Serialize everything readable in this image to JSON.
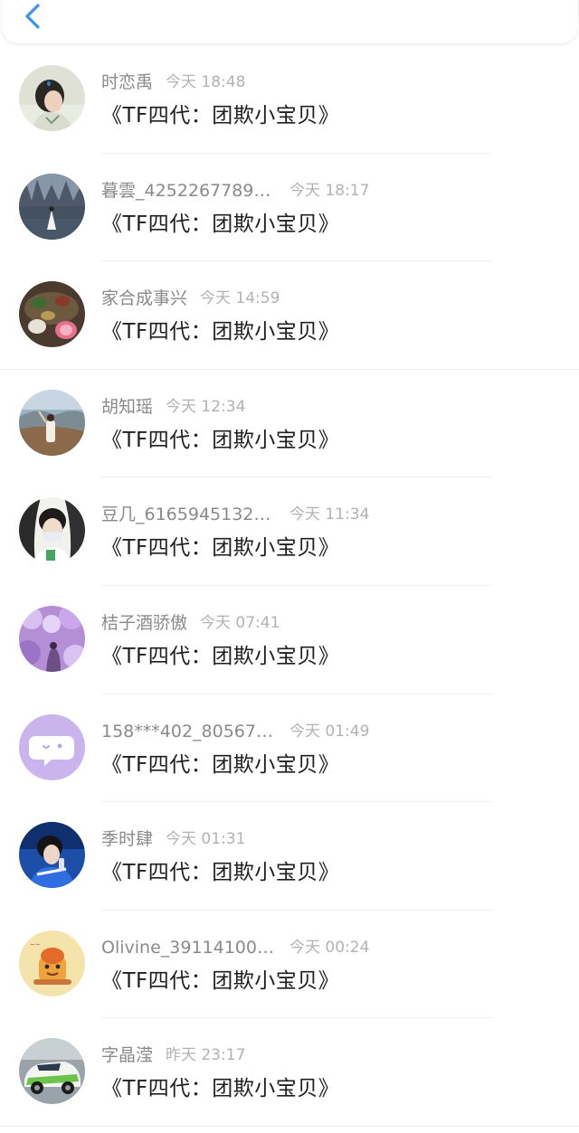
{
  "header": {
    "back_icon": "chevron-left-icon",
    "accent_color": "#3d8ff0"
  },
  "messages": [
    {
      "name": "时恋禹",
      "time": "今天 18:48",
      "text": "《TF四代：团欺小宝贝》",
      "avatar": "avatar-person-photo"
    },
    {
      "name": "暮雲_4252267789…",
      "time": "今天 18:17",
      "text": "《TF四代：团欺小宝贝》",
      "avatar": "avatar-misty-forest"
    },
    {
      "name": "家合成事兴",
      "time": "今天 14:59",
      "text": "《TF四代：团欺小宝贝》",
      "avatar": "avatar-food-table"
    },
    {
      "name": "胡知瑶",
      "time": "今天 12:34",
      "text": "《TF四代：团欺小宝贝》",
      "avatar": "avatar-mountain-girl"
    },
    {
      "name": "豆几_6165945132…",
      "time": "今天 11:34",
      "text": "《TF四代：团欺小宝贝》",
      "avatar": "avatar-masked-boy"
    },
    {
      "name": "桔子酒骄傲",
      "time": "今天 07:41",
      "text": "《TF四代：团欺小宝贝》",
      "avatar": "avatar-purple-blossom"
    },
    {
      "name": "158***402_80567…",
      "time": "今天 01:49",
      "text": "《TF四代：团欺小宝贝》",
      "avatar": "avatar-default-chat-bubble"
    },
    {
      "name": "季时肆",
      "time": "今天 01:31",
      "text": "《TF四代：团欺小宝贝》",
      "avatar": "avatar-blue-performer"
    },
    {
      "name": "Olivine_39114100…",
      "time": "今天 00:24",
      "text": "《TF四代：团欺小宝贝》",
      "avatar": "avatar-cartoon-character"
    },
    {
      "name": "字晶滢",
      "time": "昨天 23:17",
      "text": "《TF四代：团欺小宝贝》",
      "avatar": "avatar-rally-car"
    }
  ]
}
